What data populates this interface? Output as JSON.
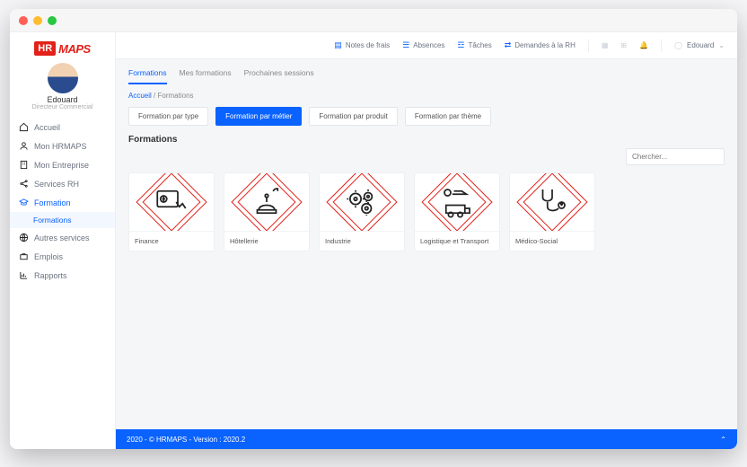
{
  "logo": {
    "box": "HR",
    "text": "MAPS"
  },
  "user": {
    "name": "Edouard",
    "role": "Directeur Commercial"
  },
  "sidebar": {
    "items": [
      {
        "label": "Accueil"
      },
      {
        "label": "Mon HRMAPS"
      },
      {
        "label": "Mon Entreprise"
      },
      {
        "label": "Services RH"
      },
      {
        "label": "Formation",
        "active": true,
        "sub": "Formations"
      },
      {
        "label": "Autres services"
      },
      {
        "label": "Emplois"
      },
      {
        "label": "Rapports"
      }
    ]
  },
  "topbar": {
    "links": [
      {
        "label": "Notes de frais"
      },
      {
        "label": "Absences"
      },
      {
        "label": "Tâches"
      },
      {
        "label": "Demandes à la RH"
      }
    ],
    "username": "Edouard"
  },
  "tabs": [
    {
      "label": "Formations",
      "active": true
    },
    {
      "label": "Mes formations"
    },
    {
      "label": "Prochaines sessions"
    }
  ],
  "breadcrumb": {
    "root": "Accueil",
    "sep": "/",
    "current": "Formations"
  },
  "filters": [
    {
      "label": "Formation par type"
    },
    {
      "label": "Formation par métier",
      "active": true
    },
    {
      "label": "Formation par produit"
    },
    {
      "label": "Formation par thème"
    }
  ],
  "section_title": "Formations",
  "search": {
    "placeholder": "Chercher..."
  },
  "cards": [
    {
      "label": "Finance"
    },
    {
      "label": "Hôtellerie"
    },
    {
      "label": "Industrie"
    },
    {
      "label": "Logistique et Transport"
    },
    {
      "label": "Médico-Social"
    }
  ],
  "footer": "2020 - © HRMAPS - Version : 2020.2"
}
